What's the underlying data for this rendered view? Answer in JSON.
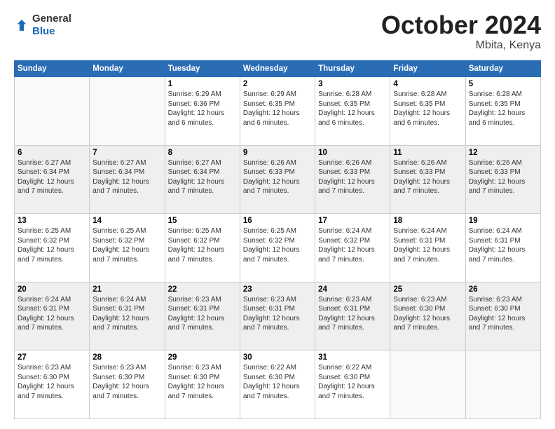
{
  "header": {
    "logo_general": "General",
    "logo_blue": "Blue",
    "month_title": "October 2024",
    "location": "Mbita, Kenya"
  },
  "weekdays": [
    "Sunday",
    "Monday",
    "Tuesday",
    "Wednesday",
    "Thursday",
    "Friday",
    "Saturday"
  ],
  "weeks": [
    [
      {
        "day": "",
        "info": ""
      },
      {
        "day": "",
        "info": ""
      },
      {
        "day": "1",
        "info": "Sunrise: 6:29 AM\nSunset: 6:36 PM\nDaylight: 12 hours\nand 6 minutes."
      },
      {
        "day": "2",
        "info": "Sunrise: 6:29 AM\nSunset: 6:35 PM\nDaylight: 12 hours\nand 6 minutes."
      },
      {
        "day": "3",
        "info": "Sunrise: 6:28 AM\nSunset: 6:35 PM\nDaylight: 12 hours\nand 6 minutes."
      },
      {
        "day": "4",
        "info": "Sunrise: 6:28 AM\nSunset: 6:35 PM\nDaylight: 12 hours\nand 6 minutes."
      },
      {
        "day": "5",
        "info": "Sunrise: 6:28 AM\nSunset: 6:35 PM\nDaylight: 12 hours\nand 6 minutes."
      }
    ],
    [
      {
        "day": "6",
        "info": "Sunrise: 6:27 AM\nSunset: 6:34 PM\nDaylight: 12 hours\nand 7 minutes."
      },
      {
        "day": "7",
        "info": "Sunrise: 6:27 AM\nSunset: 6:34 PM\nDaylight: 12 hours\nand 7 minutes."
      },
      {
        "day": "8",
        "info": "Sunrise: 6:27 AM\nSunset: 6:34 PM\nDaylight: 12 hours\nand 7 minutes."
      },
      {
        "day": "9",
        "info": "Sunrise: 6:26 AM\nSunset: 6:33 PM\nDaylight: 12 hours\nand 7 minutes."
      },
      {
        "day": "10",
        "info": "Sunrise: 6:26 AM\nSunset: 6:33 PM\nDaylight: 12 hours\nand 7 minutes."
      },
      {
        "day": "11",
        "info": "Sunrise: 6:26 AM\nSunset: 6:33 PM\nDaylight: 12 hours\nand 7 minutes."
      },
      {
        "day": "12",
        "info": "Sunrise: 6:26 AM\nSunset: 6:33 PM\nDaylight: 12 hours\nand 7 minutes."
      }
    ],
    [
      {
        "day": "13",
        "info": "Sunrise: 6:25 AM\nSunset: 6:32 PM\nDaylight: 12 hours\nand 7 minutes."
      },
      {
        "day": "14",
        "info": "Sunrise: 6:25 AM\nSunset: 6:32 PM\nDaylight: 12 hours\nand 7 minutes."
      },
      {
        "day": "15",
        "info": "Sunrise: 6:25 AM\nSunset: 6:32 PM\nDaylight: 12 hours\nand 7 minutes."
      },
      {
        "day": "16",
        "info": "Sunrise: 6:25 AM\nSunset: 6:32 PM\nDaylight: 12 hours\nand 7 minutes."
      },
      {
        "day": "17",
        "info": "Sunrise: 6:24 AM\nSunset: 6:32 PM\nDaylight: 12 hours\nand 7 minutes."
      },
      {
        "day": "18",
        "info": "Sunrise: 6:24 AM\nSunset: 6:31 PM\nDaylight: 12 hours\nand 7 minutes."
      },
      {
        "day": "19",
        "info": "Sunrise: 6:24 AM\nSunset: 6:31 PM\nDaylight: 12 hours\nand 7 minutes."
      }
    ],
    [
      {
        "day": "20",
        "info": "Sunrise: 6:24 AM\nSunset: 6:31 PM\nDaylight: 12 hours\nand 7 minutes."
      },
      {
        "day": "21",
        "info": "Sunrise: 6:24 AM\nSunset: 6:31 PM\nDaylight: 12 hours\nand 7 minutes."
      },
      {
        "day": "22",
        "info": "Sunrise: 6:23 AM\nSunset: 6:31 PM\nDaylight: 12 hours\nand 7 minutes."
      },
      {
        "day": "23",
        "info": "Sunrise: 6:23 AM\nSunset: 6:31 PM\nDaylight: 12 hours\nand 7 minutes."
      },
      {
        "day": "24",
        "info": "Sunrise: 6:23 AM\nSunset: 6:31 PM\nDaylight: 12 hours\nand 7 minutes."
      },
      {
        "day": "25",
        "info": "Sunrise: 6:23 AM\nSunset: 6:30 PM\nDaylight: 12 hours\nand 7 minutes."
      },
      {
        "day": "26",
        "info": "Sunrise: 6:23 AM\nSunset: 6:30 PM\nDaylight: 12 hours\nand 7 minutes."
      }
    ],
    [
      {
        "day": "27",
        "info": "Sunrise: 6:23 AM\nSunset: 6:30 PM\nDaylight: 12 hours\nand 7 minutes."
      },
      {
        "day": "28",
        "info": "Sunrise: 6:23 AM\nSunset: 6:30 PM\nDaylight: 12 hours\nand 7 minutes."
      },
      {
        "day": "29",
        "info": "Sunrise: 6:23 AM\nSunset: 6:30 PM\nDaylight: 12 hours\nand 7 minutes."
      },
      {
        "day": "30",
        "info": "Sunrise: 6:22 AM\nSunset: 6:30 PM\nDaylight: 12 hours\nand 7 minutes."
      },
      {
        "day": "31",
        "info": "Sunrise: 6:22 AM\nSunset: 6:30 PM\nDaylight: 12 hours\nand 7 minutes."
      },
      {
        "day": "",
        "info": ""
      },
      {
        "day": "",
        "info": ""
      }
    ]
  ]
}
